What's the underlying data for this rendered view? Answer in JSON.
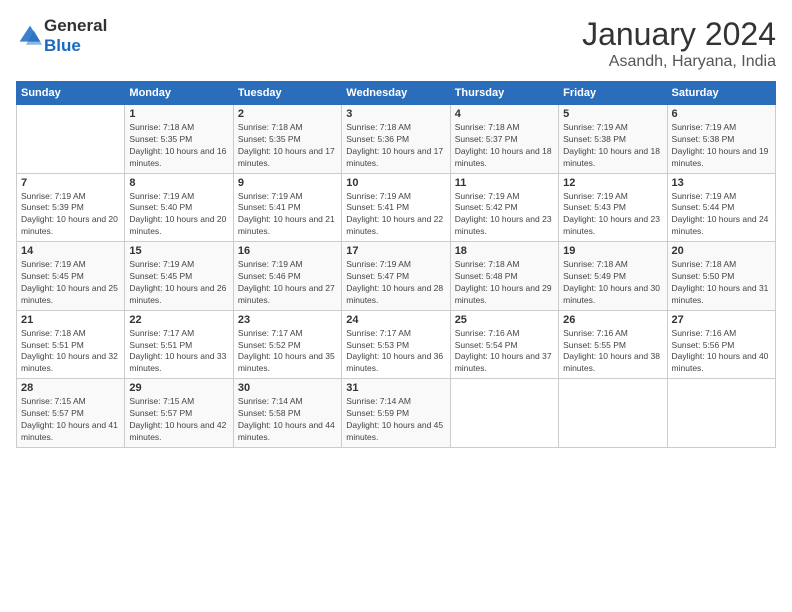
{
  "logo": {
    "general": "General",
    "blue": "Blue"
  },
  "title": "January 2024",
  "location": "Asandh, Haryana, India",
  "headers": [
    "Sunday",
    "Monday",
    "Tuesday",
    "Wednesday",
    "Thursday",
    "Friday",
    "Saturday"
  ],
  "weeks": [
    [
      {
        "day": "",
        "sunrise": "",
        "sunset": "",
        "daylight": ""
      },
      {
        "day": "1",
        "sunrise": "Sunrise: 7:18 AM",
        "sunset": "Sunset: 5:35 PM",
        "daylight": "Daylight: 10 hours and 16 minutes."
      },
      {
        "day": "2",
        "sunrise": "Sunrise: 7:18 AM",
        "sunset": "Sunset: 5:35 PM",
        "daylight": "Daylight: 10 hours and 17 minutes."
      },
      {
        "day": "3",
        "sunrise": "Sunrise: 7:18 AM",
        "sunset": "Sunset: 5:36 PM",
        "daylight": "Daylight: 10 hours and 17 minutes."
      },
      {
        "day": "4",
        "sunrise": "Sunrise: 7:18 AM",
        "sunset": "Sunset: 5:37 PM",
        "daylight": "Daylight: 10 hours and 18 minutes."
      },
      {
        "day": "5",
        "sunrise": "Sunrise: 7:19 AM",
        "sunset": "Sunset: 5:38 PM",
        "daylight": "Daylight: 10 hours and 18 minutes."
      },
      {
        "day": "6",
        "sunrise": "Sunrise: 7:19 AM",
        "sunset": "Sunset: 5:38 PM",
        "daylight": "Daylight: 10 hours and 19 minutes."
      }
    ],
    [
      {
        "day": "7",
        "sunrise": "Sunrise: 7:19 AM",
        "sunset": "Sunset: 5:39 PM",
        "daylight": "Daylight: 10 hours and 20 minutes."
      },
      {
        "day": "8",
        "sunrise": "Sunrise: 7:19 AM",
        "sunset": "Sunset: 5:40 PM",
        "daylight": "Daylight: 10 hours and 20 minutes."
      },
      {
        "day": "9",
        "sunrise": "Sunrise: 7:19 AM",
        "sunset": "Sunset: 5:41 PM",
        "daylight": "Daylight: 10 hours and 21 minutes."
      },
      {
        "day": "10",
        "sunrise": "Sunrise: 7:19 AM",
        "sunset": "Sunset: 5:41 PM",
        "daylight": "Daylight: 10 hours and 22 minutes."
      },
      {
        "day": "11",
        "sunrise": "Sunrise: 7:19 AM",
        "sunset": "Sunset: 5:42 PM",
        "daylight": "Daylight: 10 hours and 23 minutes."
      },
      {
        "day": "12",
        "sunrise": "Sunrise: 7:19 AM",
        "sunset": "Sunset: 5:43 PM",
        "daylight": "Daylight: 10 hours and 23 minutes."
      },
      {
        "day": "13",
        "sunrise": "Sunrise: 7:19 AM",
        "sunset": "Sunset: 5:44 PM",
        "daylight": "Daylight: 10 hours and 24 minutes."
      }
    ],
    [
      {
        "day": "14",
        "sunrise": "Sunrise: 7:19 AM",
        "sunset": "Sunset: 5:45 PM",
        "daylight": "Daylight: 10 hours and 25 minutes."
      },
      {
        "day": "15",
        "sunrise": "Sunrise: 7:19 AM",
        "sunset": "Sunset: 5:45 PM",
        "daylight": "Daylight: 10 hours and 26 minutes."
      },
      {
        "day": "16",
        "sunrise": "Sunrise: 7:19 AM",
        "sunset": "Sunset: 5:46 PM",
        "daylight": "Daylight: 10 hours and 27 minutes."
      },
      {
        "day": "17",
        "sunrise": "Sunrise: 7:19 AM",
        "sunset": "Sunset: 5:47 PM",
        "daylight": "Daylight: 10 hours and 28 minutes."
      },
      {
        "day": "18",
        "sunrise": "Sunrise: 7:18 AM",
        "sunset": "Sunset: 5:48 PM",
        "daylight": "Daylight: 10 hours and 29 minutes."
      },
      {
        "day": "19",
        "sunrise": "Sunrise: 7:18 AM",
        "sunset": "Sunset: 5:49 PM",
        "daylight": "Daylight: 10 hours and 30 minutes."
      },
      {
        "day": "20",
        "sunrise": "Sunrise: 7:18 AM",
        "sunset": "Sunset: 5:50 PM",
        "daylight": "Daylight: 10 hours and 31 minutes."
      }
    ],
    [
      {
        "day": "21",
        "sunrise": "Sunrise: 7:18 AM",
        "sunset": "Sunset: 5:51 PM",
        "daylight": "Daylight: 10 hours and 32 minutes."
      },
      {
        "day": "22",
        "sunrise": "Sunrise: 7:17 AM",
        "sunset": "Sunset: 5:51 PM",
        "daylight": "Daylight: 10 hours and 33 minutes."
      },
      {
        "day": "23",
        "sunrise": "Sunrise: 7:17 AM",
        "sunset": "Sunset: 5:52 PM",
        "daylight": "Daylight: 10 hours and 35 minutes."
      },
      {
        "day": "24",
        "sunrise": "Sunrise: 7:17 AM",
        "sunset": "Sunset: 5:53 PM",
        "daylight": "Daylight: 10 hours and 36 minutes."
      },
      {
        "day": "25",
        "sunrise": "Sunrise: 7:16 AM",
        "sunset": "Sunset: 5:54 PM",
        "daylight": "Daylight: 10 hours and 37 minutes."
      },
      {
        "day": "26",
        "sunrise": "Sunrise: 7:16 AM",
        "sunset": "Sunset: 5:55 PM",
        "daylight": "Daylight: 10 hours and 38 minutes."
      },
      {
        "day": "27",
        "sunrise": "Sunrise: 7:16 AM",
        "sunset": "Sunset: 5:56 PM",
        "daylight": "Daylight: 10 hours and 40 minutes."
      }
    ],
    [
      {
        "day": "28",
        "sunrise": "Sunrise: 7:15 AM",
        "sunset": "Sunset: 5:57 PM",
        "daylight": "Daylight: 10 hours and 41 minutes."
      },
      {
        "day": "29",
        "sunrise": "Sunrise: 7:15 AM",
        "sunset": "Sunset: 5:57 PM",
        "daylight": "Daylight: 10 hours and 42 minutes."
      },
      {
        "day": "30",
        "sunrise": "Sunrise: 7:14 AM",
        "sunset": "Sunset: 5:58 PM",
        "daylight": "Daylight: 10 hours and 44 minutes."
      },
      {
        "day": "31",
        "sunrise": "Sunrise: 7:14 AM",
        "sunset": "Sunset: 5:59 PM",
        "daylight": "Daylight: 10 hours and 45 minutes."
      },
      {
        "day": "",
        "sunrise": "",
        "sunset": "",
        "daylight": ""
      },
      {
        "day": "",
        "sunrise": "",
        "sunset": "",
        "daylight": ""
      },
      {
        "day": "",
        "sunrise": "",
        "sunset": "",
        "daylight": ""
      }
    ]
  ]
}
